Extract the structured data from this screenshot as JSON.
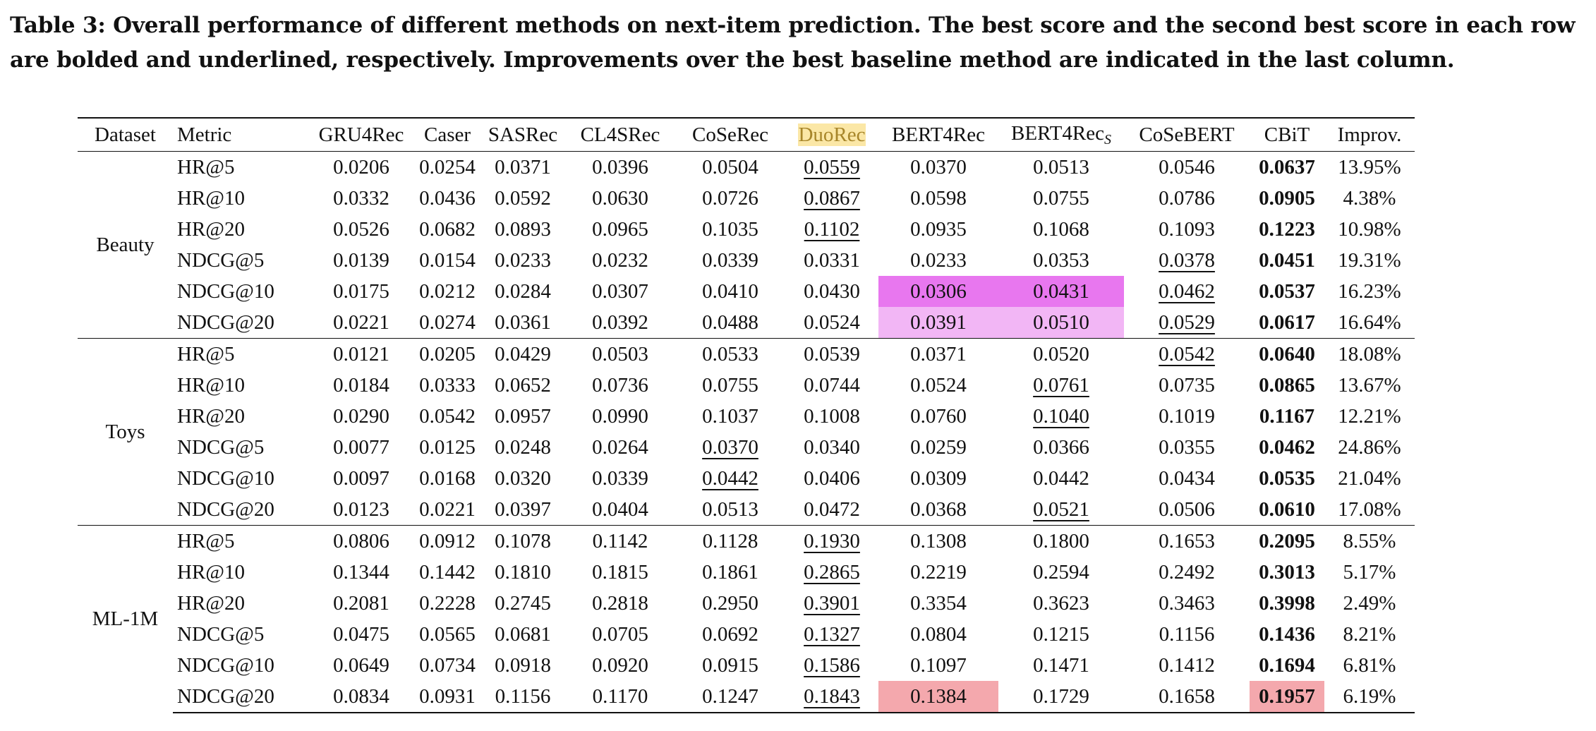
{
  "caption": "Table 3: Overall performance of different methods on next-item prediction. The best score and the second best score in each row are bolded and underlined, respectively. Improvements over the best baseline method are indicated in the last column.",
  "headers": {
    "dataset": "Dataset",
    "metric": "Metric",
    "gru4rec": "GRU4Rec",
    "caser": "Caser",
    "sasrec": "SASRec",
    "cl4srec": "CL4SRec",
    "cosrec": "CoSeRec",
    "duorec": "DuoRec",
    "bert4rec": "BERT4Rec",
    "bert4recs_base": "BERT4Rec",
    "bert4recs_sub": "S",
    "cosebert": "CoSeBERT",
    "cbit": "CBiT",
    "improv": "Improv."
  },
  "highlight_colors": {
    "header_duorec": "#fbe7a6",
    "magenta": "#e877ef",
    "light_pink": "#f2b6f5",
    "salmon": "#f4a8ad"
  },
  "groups": [
    {
      "dataset": "Beauty",
      "rows": [
        {
          "metric": "HR@5",
          "values": [
            "0.0206",
            "0.0254",
            "0.0371",
            "0.0396",
            "0.0504",
            "0.0559",
            "0.0370",
            "0.0513",
            "0.0546",
            "0.0637",
            "13.95%"
          ]
        },
        {
          "metric": "HR@10",
          "values": [
            "0.0332",
            "0.0436",
            "0.0592",
            "0.0630",
            "0.0726",
            "0.0867",
            "0.0598",
            "0.0755",
            "0.0786",
            "0.0905",
            "4.38%"
          ]
        },
        {
          "metric": "HR@20",
          "values": [
            "0.0526",
            "0.0682",
            "0.0893",
            "0.0965",
            "0.1035",
            "0.1102",
            "0.0935",
            "0.1068",
            "0.1093",
            "0.1223",
            "10.98%"
          ]
        },
        {
          "metric": "NDCG@5",
          "values": [
            "0.0139",
            "0.0154",
            "0.0233",
            "0.0232",
            "0.0339",
            "0.0331",
            "0.0233",
            "0.0353",
            "0.0378",
            "0.0451",
            "19.31%"
          ]
        },
        {
          "metric": "NDCG@10",
          "values": [
            "0.0175",
            "0.0212",
            "0.0284",
            "0.0307",
            "0.0410",
            "0.0430",
            "0.0306",
            "0.0431",
            "0.0462",
            "0.0537",
            "16.23%"
          ]
        },
        {
          "metric": "NDCG@20",
          "values": [
            "0.0221",
            "0.0274",
            "0.0361",
            "0.0392",
            "0.0488",
            "0.0524",
            "0.0391",
            "0.0510",
            "0.0529",
            "0.0617",
            "16.64%"
          ]
        }
      ]
    },
    {
      "dataset": "Toys",
      "rows": [
        {
          "metric": "HR@5",
          "values": [
            "0.0121",
            "0.0205",
            "0.0429",
            "0.0503",
            "0.0533",
            "0.0539",
            "0.0371",
            "0.0520",
            "0.0542",
            "0.0640",
            "18.08%"
          ]
        },
        {
          "metric": "HR@10",
          "values": [
            "0.0184",
            "0.0333",
            "0.0652",
            "0.0736",
            "0.0755",
            "0.0744",
            "0.0524",
            "0.0761",
            "0.0735",
            "0.0865",
            "13.67%"
          ]
        },
        {
          "metric": "HR@20",
          "values": [
            "0.0290",
            "0.0542",
            "0.0957",
            "0.0990",
            "0.1037",
            "0.1008",
            "0.0760",
            "0.1040",
            "0.1019",
            "0.1167",
            "12.21%"
          ]
        },
        {
          "metric": "NDCG@5",
          "values": [
            "0.0077",
            "0.0125",
            "0.0248",
            "0.0264",
            "0.0370",
            "0.0340",
            "0.0259",
            "0.0366",
            "0.0355",
            "0.0462",
            "24.86%"
          ]
        },
        {
          "metric": "NDCG@10",
          "values": [
            "0.0097",
            "0.0168",
            "0.0320",
            "0.0339",
            "0.0442",
            "0.0406",
            "0.0309",
            "0.0442",
            "0.0434",
            "0.0535",
            "21.04%"
          ]
        },
        {
          "metric": "NDCG@20",
          "values": [
            "0.0123",
            "0.0221",
            "0.0397",
            "0.0404",
            "0.0513",
            "0.0472",
            "0.0368",
            "0.0521",
            "0.0506",
            "0.0610",
            "17.08%"
          ]
        }
      ]
    },
    {
      "dataset": "ML-1M",
      "rows": [
        {
          "metric": "HR@5",
          "values": [
            "0.0806",
            "0.0912",
            "0.1078",
            "0.1142",
            "0.1128",
            "0.1930",
            "0.1308",
            "0.1800",
            "0.1653",
            "0.2095",
            "8.55%"
          ]
        },
        {
          "metric": "HR@10",
          "values": [
            "0.1344",
            "0.1442",
            "0.1810",
            "0.1815",
            "0.1861",
            "0.2865",
            "0.2219",
            "0.2594",
            "0.2492",
            "0.3013",
            "5.17%"
          ]
        },
        {
          "metric": "HR@20",
          "values": [
            "0.2081",
            "0.2228",
            "0.2745",
            "0.2818",
            "0.2950",
            "0.3901",
            "0.3354",
            "0.3623",
            "0.3463",
            "0.3998",
            "2.49%"
          ]
        },
        {
          "metric": "NDCG@5",
          "values": [
            "0.0475",
            "0.0565",
            "0.0681",
            "0.0705",
            "0.0692",
            "0.1327",
            "0.0804",
            "0.1215",
            "0.1156",
            "0.1436",
            "8.21%"
          ]
        },
        {
          "metric": "NDCG@10",
          "values": [
            "0.0649",
            "0.0734",
            "0.0918",
            "0.0920",
            "0.0915",
            "0.1586",
            "0.1097",
            "0.1471",
            "0.1412",
            "0.1694",
            "6.81%"
          ]
        },
        {
          "metric": "NDCG@20",
          "values": [
            "0.0834",
            "0.0931",
            "0.1156",
            "0.1170",
            "0.1247",
            "0.1843",
            "0.1384",
            "0.1729",
            "0.1658",
            "0.1957",
            "6.19%"
          ]
        }
      ]
    }
  ],
  "bold_cells": [
    [
      0,
      0,
      9
    ],
    [
      0,
      1,
      9
    ],
    [
      0,
      2,
      9
    ],
    [
      0,
      3,
      9
    ],
    [
      0,
      4,
      9
    ],
    [
      0,
      5,
      9
    ],
    [
      1,
      0,
      9
    ],
    [
      1,
      1,
      9
    ],
    [
      1,
      2,
      9
    ],
    [
      1,
      3,
      9
    ],
    [
      1,
      4,
      9
    ],
    [
      1,
      5,
      9
    ],
    [
      2,
      0,
      9
    ],
    [
      2,
      1,
      9
    ],
    [
      2,
      2,
      9
    ],
    [
      2,
      3,
      9
    ],
    [
      2,
      4,
      9
    ],
    [
      2,
      5,
      9
    ]
  ],
  "underlined_cells": [
    [
      0,
      0,
      5
    ],
    [
      0,
      1,
      5
    ],
    [
      0,
      2,
      5
    ],
    [
      0,
      3,
      8
    ],
    [
      0,
      4,
      8
    ],
    [
      0,
      5,
      8
    ],
    [
      1,
      0,
      8
    ],
    [
      1,
      1,
      7
    ],
    [
      1,
      2,
      7
    ],
    [
      1,
      3,
      4
    ],
    [
      1,
      4,
      4
    ],
    [
      1,
      5,
      7
    ],
    [
      2,
      0,
      5
    ],
    [
      2,
      1,
      5
    ],
    [
      2,
      2,
      5
    ],
    [
      2,
      3,
      5
    ],
    [
      2,
      4,
      5
    ],
    [
      2,
      5,
      5
    ]
  ],
  "highlighted_cells": [
    {
      "cell": [
        0,
        4,
        6
      ],
      "color": "magenta"
    },
    {
      "cell": [
        0,
        4,
        7
      ],
      "color": "magenta"
    },
    {
      "cell": [
        0,
        5,
        6
      ],
      "color": "light_pink"
    },
    {
      "cell": [
        0,
        5,
        7
      ],
      "color": "light_pink"
    },
    {
      "cell": [
        2,
        5,
        6
      ],
      "color": "salmon"
    },
    {
      "cell": [
        2,
        5,
        9
      ],
      "color": "salmon"
    }
  ]
}
